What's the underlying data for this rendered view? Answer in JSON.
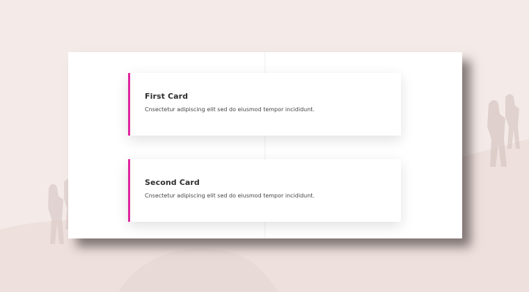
{
  "cards": [
    {
      "title": "First Card",
      "text": "Cnsectetur adipiscing elit sed do eiusmod tempor incididunt."
    },
    {
      "title": "Second Card",
      "text": "Cnsectetur adipiscing elit sed do eiusmod tempor incididunt."
    }
  ],
  "colors": {
    "accent": "#e0259f",
    "page_background": "#f4ebe8",
    "card_background": "#ffffff"
  }
}
